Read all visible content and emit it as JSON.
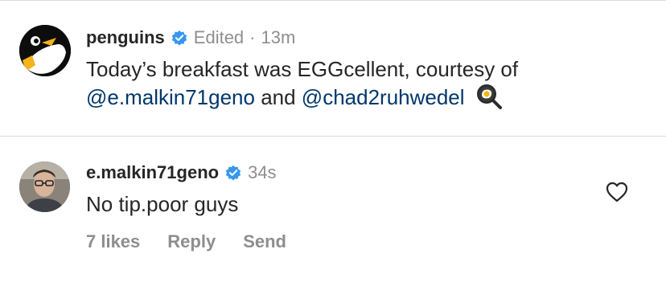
{
  "post": {
    "username": "penguins",
    "edited_label": "Edited",
    "separator": "·",
    "time": "13m",
    "caption_text": "Today’s breakfast was EGGcellent, courtesy of",
    "mention_1": "@e.malkin71geno",
    "and_text": " and ",
    "mention_2": "@chad2ruhwedel",
    "emoji_icon": "frying-pan-egg-icon"
  },
  "comment": {
    "username": "e.malkin71geno",
    "time": "34s",
    "text": "No tip.poor guys",
    "likes_label": "7 likes",
    "reply_label": "Reply",
    "send_label": "Send",
    "like_icon": "heart-icon"
  },
  "colors": {
    "verified_blue": "#3797f0",
    "mention_blue": "#00376b",
    "muted_gray": "#8e8e8e",
    "text_dark": "#262626"
  }
}
